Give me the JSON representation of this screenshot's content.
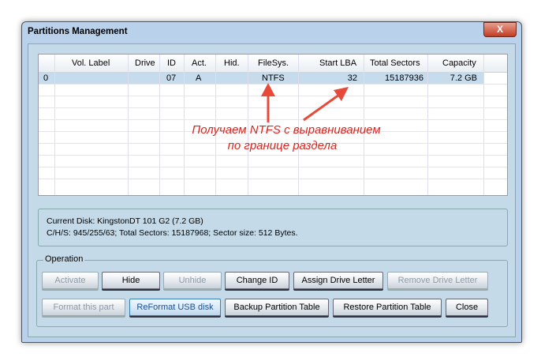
{
  "window": {
    "title": "Partitions Management",
    "close_glyph": "X"
  },
  "table": {
    "headers": [
      "",
      "Vol. Label",
      "Drive",
      "ID",
      "Act.",
      "Hid.",
      "FileSys.",
      "Start LBA",
      "Total Sectors",
      "Capacity"
    ],
    "rows": [
      [
        "0",
        "",
        "",
        "07",
        "A",
        "",
        "NTFS",
        "32",
        "15187936",
        "7.2 GB"
      ]
    ]
  },
  "info": {
    "line1": "Current Disk:  KingstonDT 101 G2 (7.2 GB)",
    "line2": "C/H/S: 945/255/63; Total Sectors: 15187968; Sector size: 512 Bytes."
  },
  "operation": {
    "label": "Operation",
    "buttons": [
      "Activate",
      "Hide",
      "Unhide",
      "Change ID",
      "Assign Drive Letter",
      "Remove Drive Letter",
      "Format this part",
      "ReFormat USB disk",
      "Backup Partition Table",
      "Restore Partition Table",
      "Close"
    ]
  },
  "annotation": {
    "line1": "Получаем NTFS с  выравниванием",
    "line2": "по границе раздела",
    "color": "#e0221c"
  }
}
